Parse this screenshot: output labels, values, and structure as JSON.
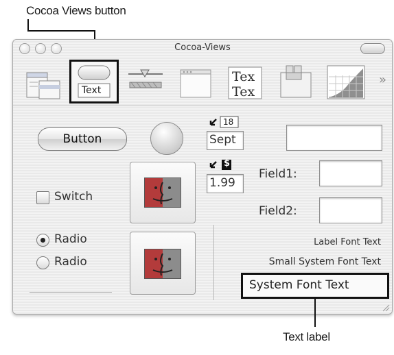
{
  "annotations": {
    "top_label": "Cocoa Views button",
    "bottom_label": "Text label"
  },
  "window": {
    "title": "Cocoa-Views"
  },
  "palette": {
    "items": [
      {
        "icon": "menu-palette-icon"
      },
      {
        "icon": "views-palette-icon",
        "label": "Text",
        "selected": true
      },
      {
        "icon": "controls-palette-icon"
      },
      {
        "icon": "windows-palette-icon"
      },
      {
        "icon": "text-palette-icon",
        "label": "Tex"
      },
      {
        "icon": "containers-palette-icon"
      },
      {
        "icon": "graphics-palette-icon"
      }
    ],
    "more": "»"
  },
  "controls": {
    "button_label": "Button",
    "switch_label": "Switch",
    "radio_selected_label": "Radio",
    "radio_unselected_label": "Radio",
    "date_badge": "18",
    "date_value": "Sept",
    "number_badge": "$",
    "number_value": "1.99",
    "field1_label": "Field1:",
    "field2_label": "Field2:",
    "label_font_text": "Label Font Text",
    "small_system_font_text": "Small System Font Text",
    "system_font_text": "System Font Text"
  },
  "colors": {
    "callout_border": "#111111",
    "finder_face": "#b23a3a"
  }
}
